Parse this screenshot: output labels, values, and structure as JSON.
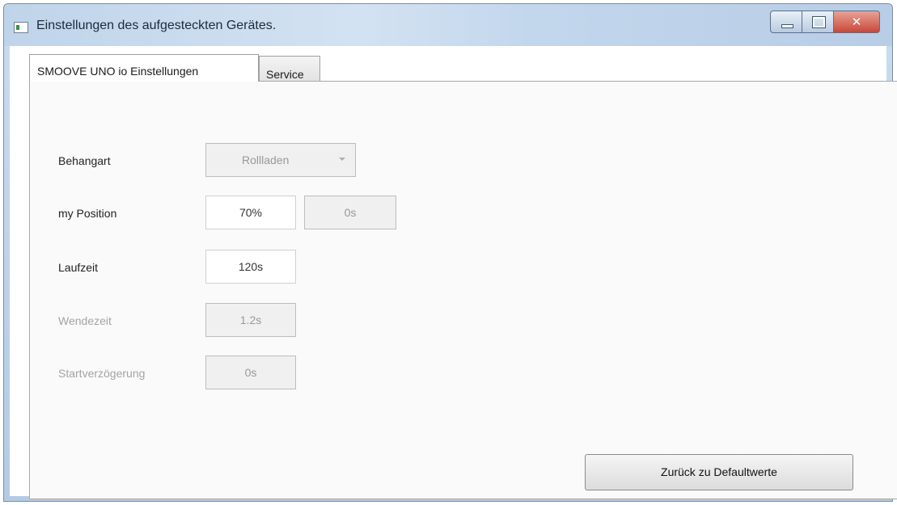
{
  "window": {
    "title": "Einstellungen des aufgesteckten Gerätes."
  },
  "tabs": [
    {
      "label": "SMOOVE UNO io Einstellungen",
      "active": true
    },
    {
      "label": "Service",
      "active": false
    }
  ],
  "settings": {
    "behangart": {
      "label": "Behangart",
      "value": "Rollladen"
    },
    "my_position": {
      "label": "my Position",
      "value": "70%",
      "secondary_value": "0s"
    },
    "laufzeit": {
      "label": "Laufzeit",
      "value": "120s"
    },
    "wendezeit": {
      "label": "Wendezeit",
      "value": "1.2s"
    },
    "startverzoegerung": {
      "label": "Startverzögerung",
      "value": "0s"
    }
  },
  "buttons": {
    "reset_label": "Zurück zu Defaultwerte"
  },
  "colors": {
    "title_bar": "#c2d6ec",
    "close_button": "#c9473a",
    "disabled_text": "#a3a3a3"
  }
}
